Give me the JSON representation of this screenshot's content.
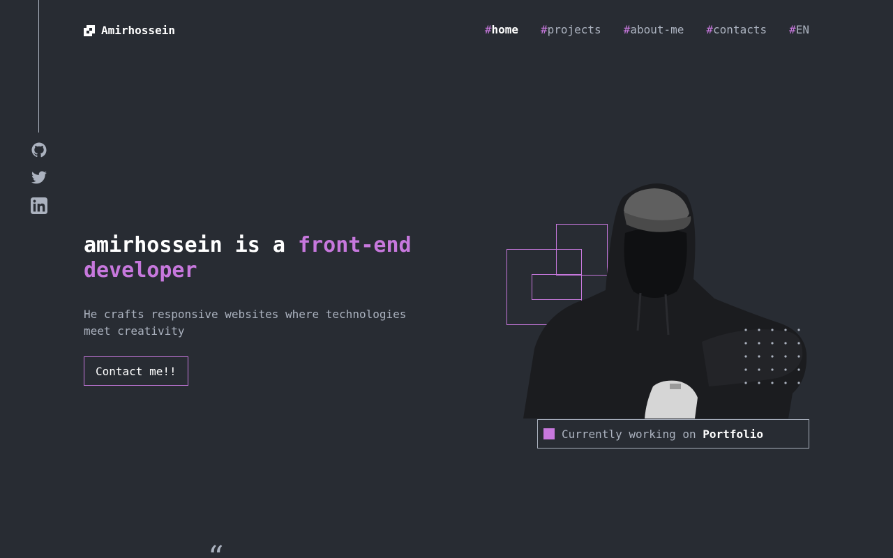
{
  "brand": {
    "name": "Amirhossein"
  },
  "nav": {
    "items": [
      {
        "hash": "#",
        "label": "home",
        "active": true
      },
      {
        "hash": "#",
        "label": "projects",
        "active": false
      },
      {
        "hash": "#",
        "label": "about-me",
        "active": false
      },
      {
        "hash": "#",
        "label": "contacts",
        "active": false
      },
      {
        "hash": "#",
        "label": "EN",
        "active": false
      }
    ]
  },
  "social": {
    "icons": [
      "github-icon",
      "twitter-icon",
      "linkedin-icon"
    ]
  },
  "hero": {
    "headline_pre": "amirhossein is a ",
    "headline_accent1": "front-end",
    "headline_accent2": "developer",
    "tagline": "He crafts responsive websites where technologies meet creativity",
    "cta_label": "Contact me!!",
    "status_prefix": "Currently working on ",
    "status_project": "Portfolio"
  },
  "next_section": {
    "quote_glyph": "“"
  },
  "colors": {
    "background": "#282c33",
    "accent": "#c778dd",
    "text": "#abb2bf",
    "heading": "#ffffff"
  }
}
